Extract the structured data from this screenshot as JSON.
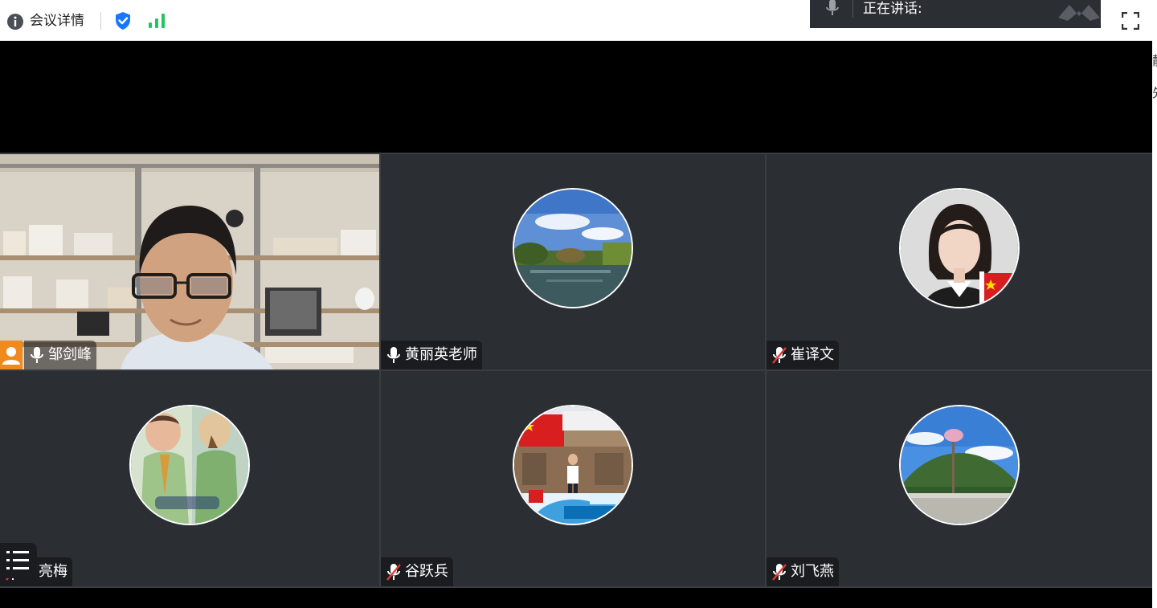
{
  "topbar": {
    "title": "会议详情",
    "icons": [
      "info-icon",
      "shield-check-icon",
      "signal-bars-icon",
      "fullscreen-icon"
    ]
  },
  "speaking": {
    "label": "正在讲话:"
  },
  "sidebar": {
    "cut_text_1": "静",
    "cut_text_2": "先"
  },
  "participants": [
    {
      "name": "邹剑峰",
      "mic": "on",
      "video": "on",
      "host": true
    },
    {
      "name": "黄丽英老师",
      "mic": "on",
      "video": "off"
    },
    {
      "name": "崔译文",
      "mic": "muted",
      "video": "off"
    },
    {
      "name": "罗亮梅",
      "mic": "muted",
      "video": "off"
    },
    {
      "name": "谷跃兵",
      "mic": "muted",
      "video": "off"
    },
    {
      "name": "刘飞燕",
      "mic": "muted",
      "video": "off"
    }
  ],
  "colors": {
    "tile_bg": "#2b2e33",
    "shield": "#1677ff",
    "signal": "#22c55e",
    "host_badge": "#f08a1c"
  }
}
